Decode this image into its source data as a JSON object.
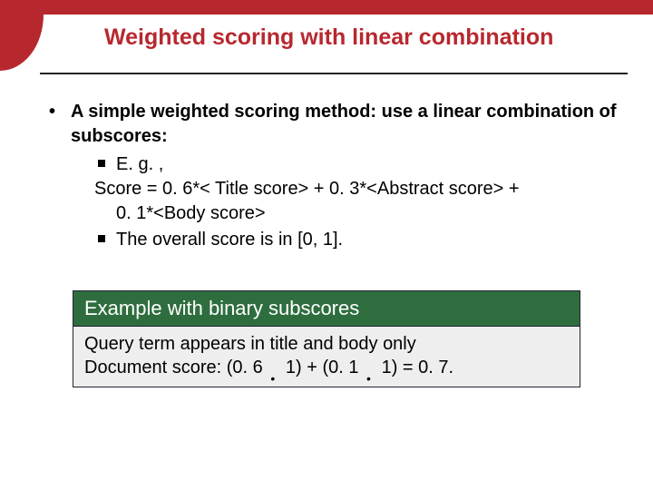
{
  "title": "Weighted  scoring with linear combination",
  "bullet1": "A simple weighted scoring method: use a linear combination of subscores:",
  "sub_eg": "E. g. ,",
  "formula_line1": "Score = 0. 6*< Title score> + 0. 3*<Abstract score> + ",
  "formula_line2": "0. 1*<Body score>",
  "sub_overall": "The overall score is in [0, 1].",
  "example_header": "Example with binary subscores",
  "example_line1": "Query term appears in title and body only",
  "example_line2_a": "Document score: (0. 6 ",
  "example_line2_b": " 1) + (0. 1 ",
  "example_line2_c": " 1) = 0. 7."
}
